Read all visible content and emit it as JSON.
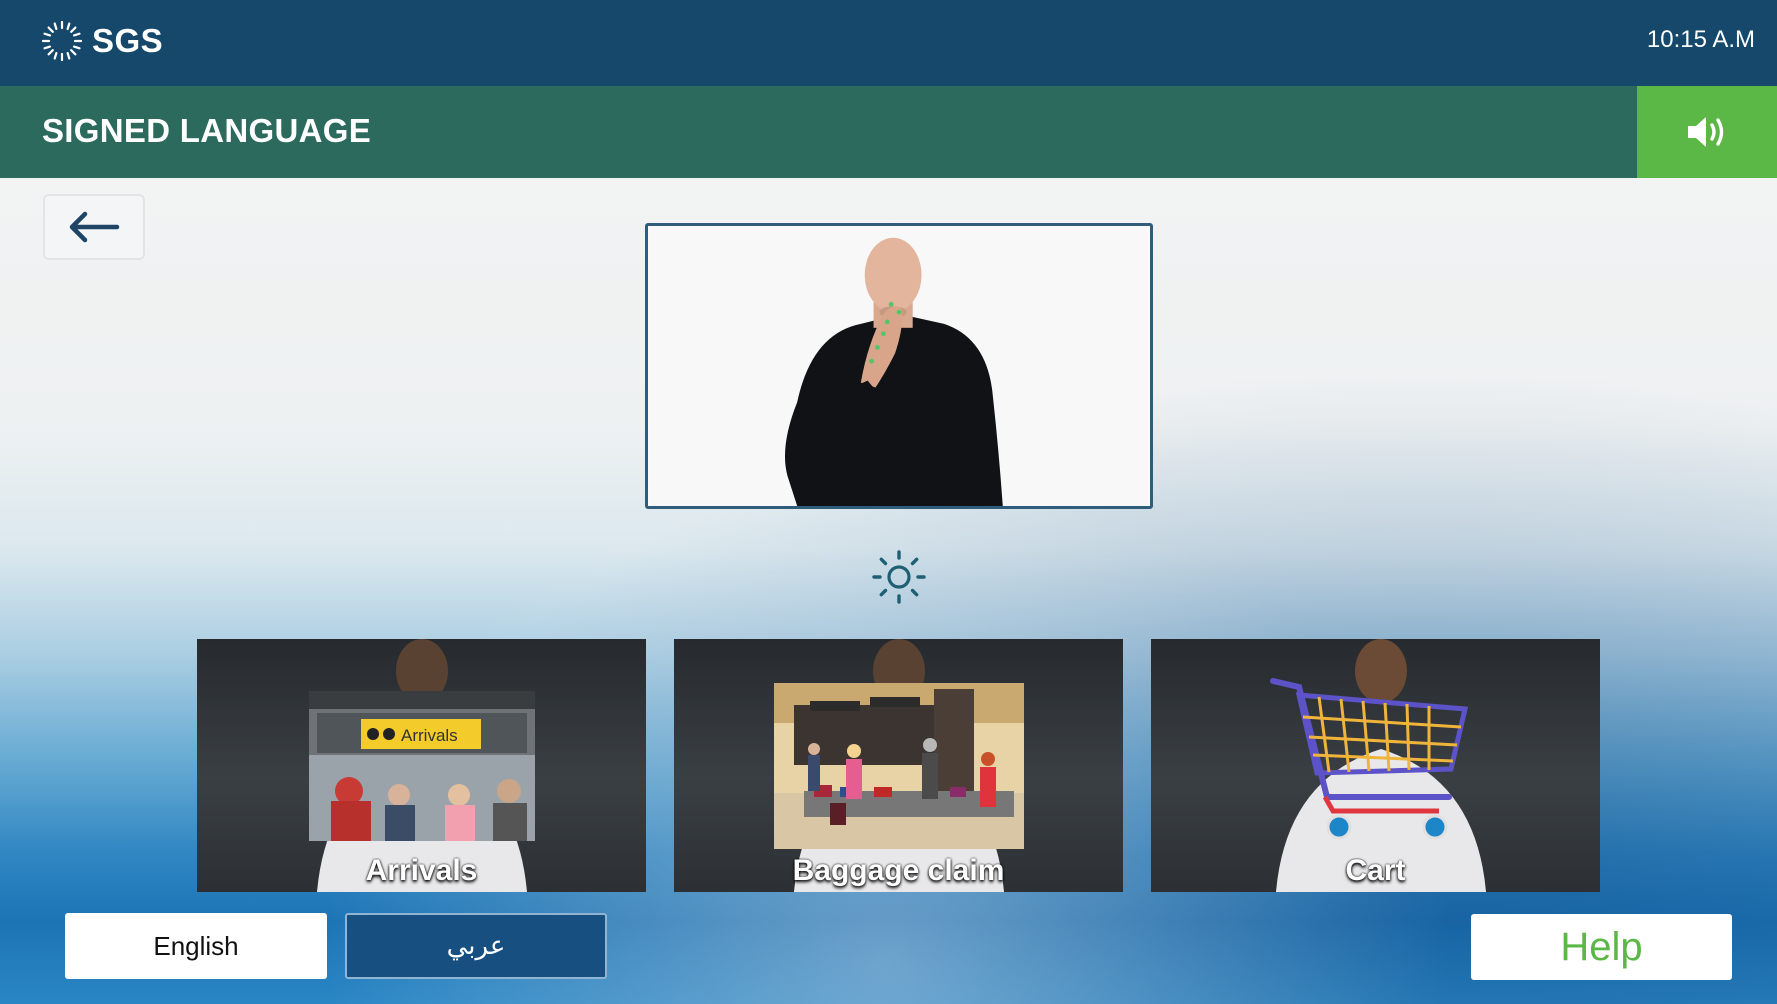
{
  "header": {
    "logo_text": "SGS",
    "time": "10:15 A.M"
  },
  "titlebar": {
    "title": "SIGNED LANGUAGE",
    "sound_icon": "speaker-icon"
  },
  "nav": {
    "back_icon": "arrow-left-icon"
  },
  "video": {
    "description_icon": "sign-language-video"
  },
  "brightness_icon": "sun-icon",
  "cards": [
    {
      "label": "Arrivals",
      "sign_text": "Arrivals"
    },
    {
      "label": "Baggage claim"
    },
    {
      "label": "Cart"
    }
  ],
  "footer": {
    "lang_english": "English",
    "lang_arabic": "عربي",
    "help": "Help"
  },
  "colors": {
    "topbar": "#15486a",
    "titlebar": "#2b6a5d",
    "accent_green": "#5cb846"
  }
}
